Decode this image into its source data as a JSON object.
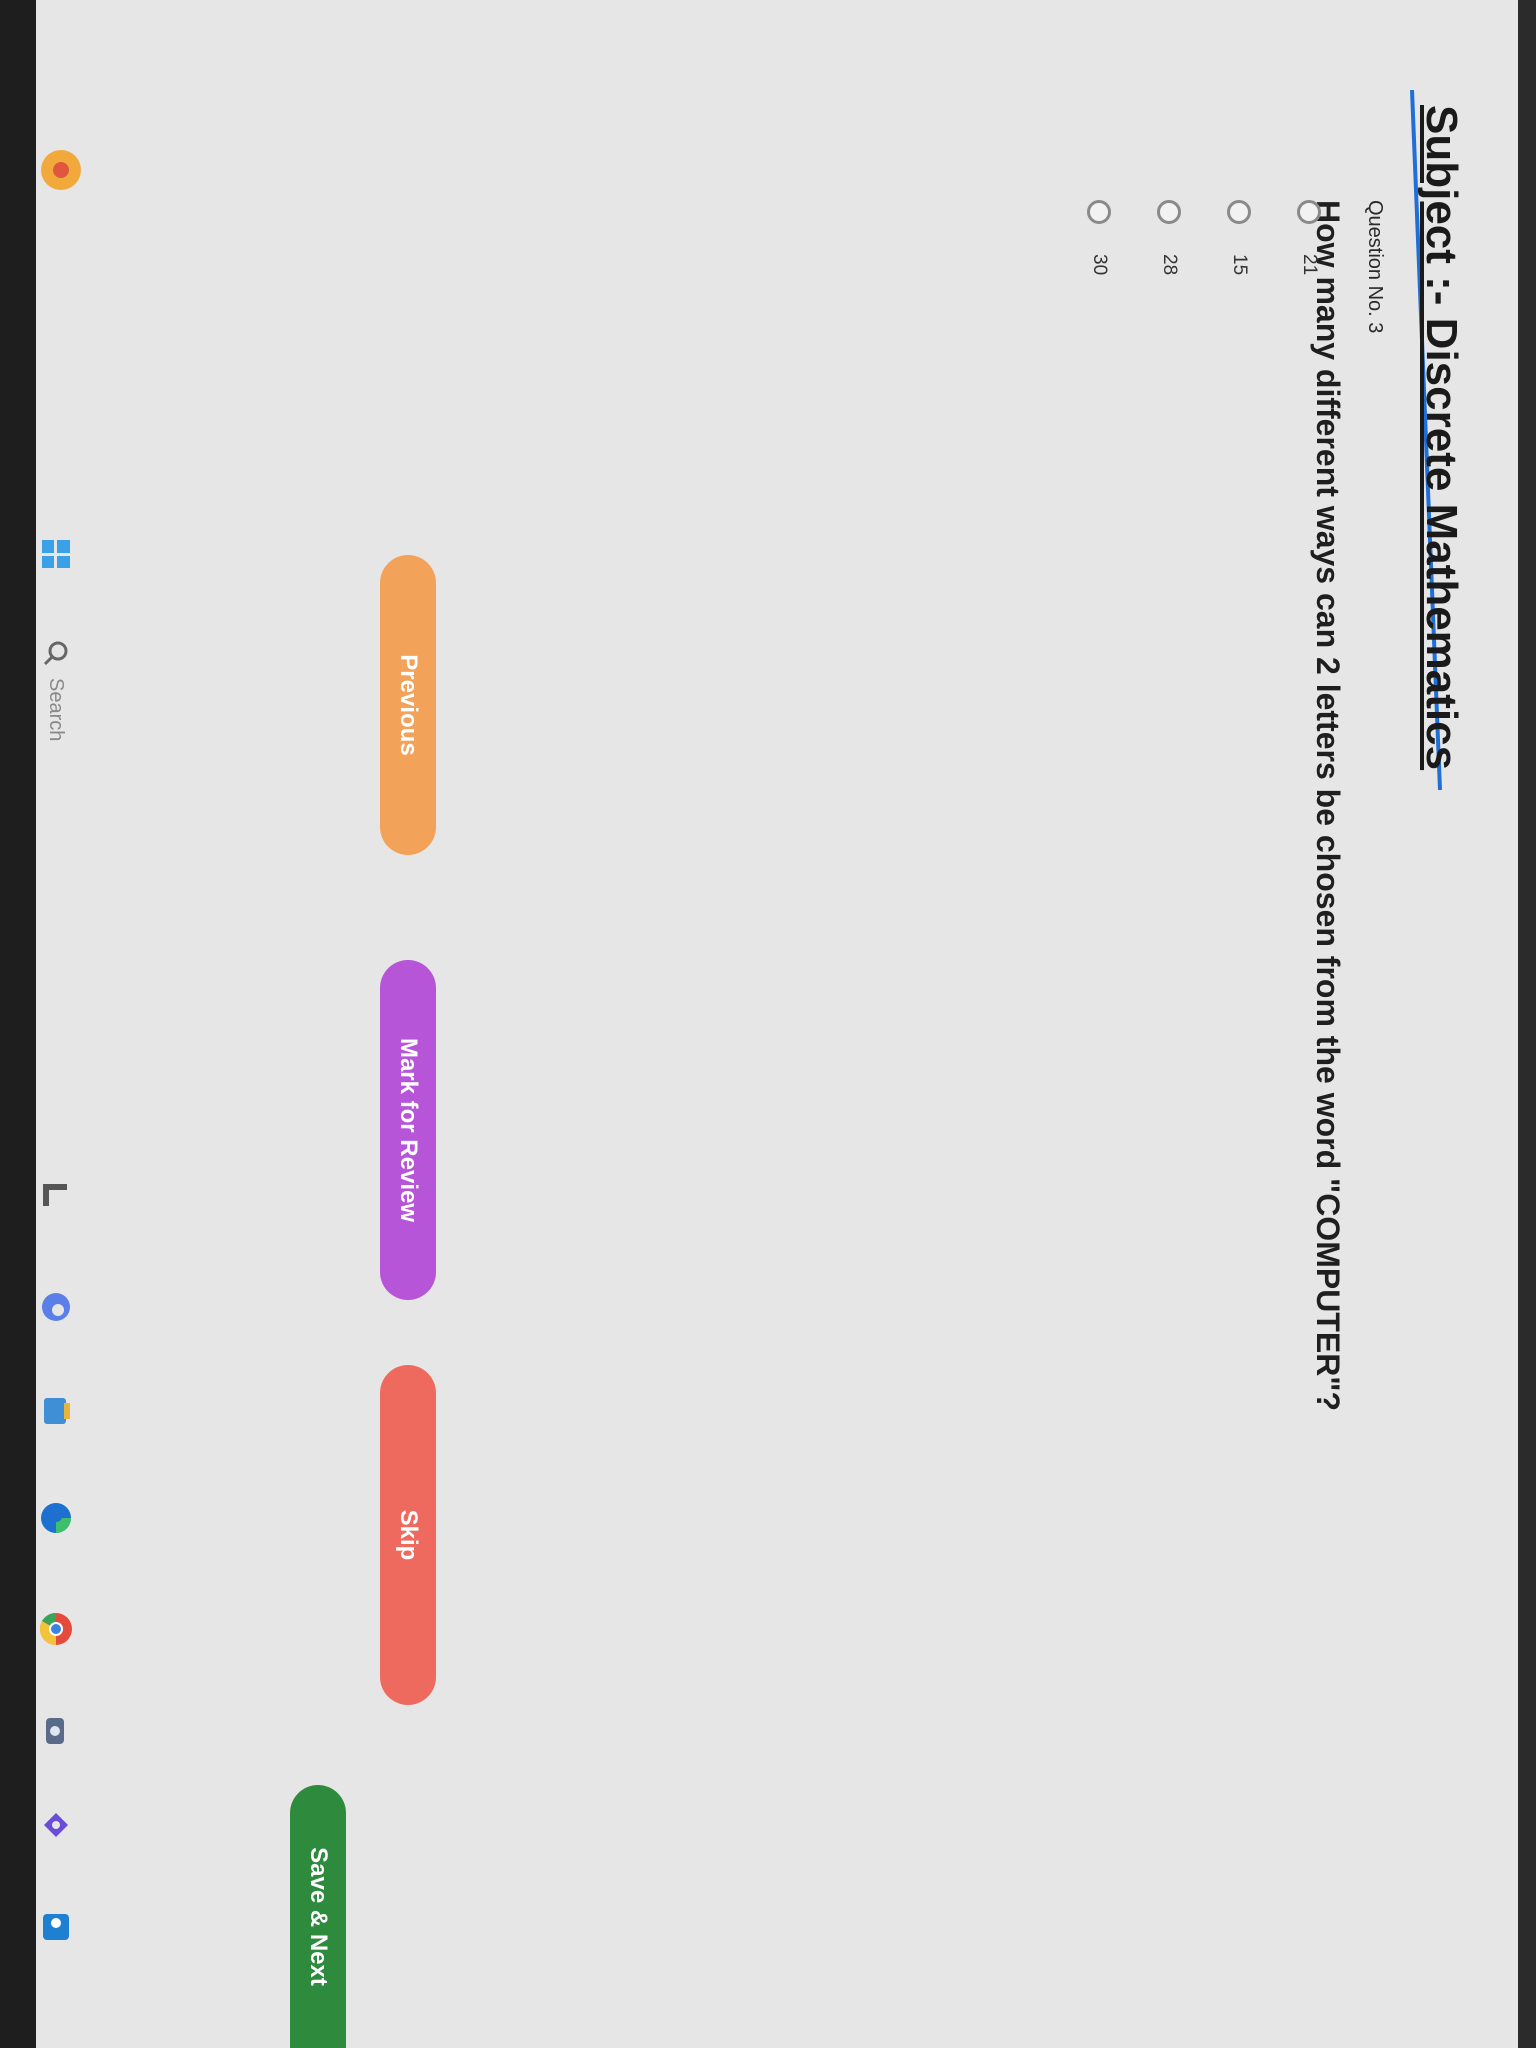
{
  "subject": {
    "label": "Subject :- Discrete Mathematics"
  },
  "question": {
    "number_label": "Question No. 3",
    "text": "How many different ways can 2 letters be chosen from the word \"COMPUTER\"?"
  },
  "options": [
    {
      "label": "21"
    },
    {
      "label": "15"
    },
    {
      "label": "28"
    },
    {
      "label": "30"
    }
  ],
  "buttons": {
    "previous": "Previous",
    "mark_for_review": "Mark for Review",
    "skip": "Skip",
    "save_next": "Save & Next"
  },
  "taskbar": {
    "search_label": "Search",
    "icons": [
      "windows-start-icon",
      "search-icon",
      "file-explorer-icon",
      "edge-icon",
      "store-icon",
      "chrome-icon",
      "camera-icon",
      "settings-icon",
      "outlook-icon"
    ]
  },
  "colors": {
    "previous": "#f3a25a",
    "mark_for_review": "#b755d8",
    "skip": "#ee6a5f",
    "save_next": "#2e8b3e",
    "accent": "#1f6fd6"
  }
}
